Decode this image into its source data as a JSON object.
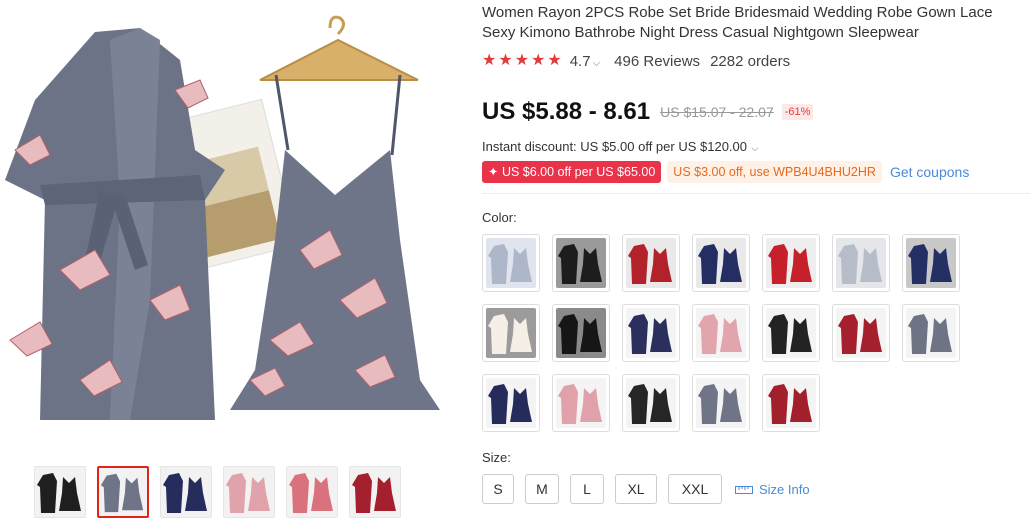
{
  "product": {
    "title": "Women Rayon 2PCS Robe Set Bride Bridesmaid Wedding Robe Gown Lace Sexy Kimono Bathrobe Night Dress Casual Nightgown Sleepwear",
    "rating": "4.7",
    "reviews": "496 Reviews",
    "orders": "2282 orders",
    "star_count": 5
  },
  "price": {
    "current": "US $5.88 - 8.61",
    "original": "US $15.07 - 22.07",
    "discount": "-61%"
  },
  "instant_discount": "Instant discount: US $5.00 off per US $120.00",
  "coupons": {
    "red": "✦ US $6.00 off per US $65.00",
    "orange": "US $3.00 off, use WPB4U4BHU2HR",
    "link": "Get coupons"
  },
  "color": {
    "label": "Color:",
    "swatches": [
      {
        "name": "light-blue-robe",
        "bg": "#dfe4ee",
        "fg": "#aeb7c9"
      },
      {
        "name": "black-set",
        "bg": "#9a9a9a",
        "fg": "#1d1d1d"
      },
      {
        "name": "red-set",
        "bg": "#e9e9e9",
        "fg": "#b3212b"
      },
      {
        "name": "navy-set",
        "bg": "#e9e9e9",
        "fg": "#252e62"
      },
      {
        "name": "red-lace",
        "bg": "#eeeeee",
        "fg": "#c6202a"
      },
      {
        "name": "silver-set",
        "bg": "#e4e6ea",
        "fg": "#b7bdc8"
      },
      {
        "name": "navy-lace",
        "bg": "#c8c8c8",
        "fg": "#243063"
      },
      {
        "name": "white-dress",
        "bg": "#9b9b9b",
        "fg": "#f6efe6"
      },
      {
        "name": "black-lace",
        "bg": "#8a8a8a",
        "fg": "#161616"
      },
      {
        "name": "navy-crane",
        "bg": "#f4f4f4",
        "fg": "#2a2f5d"
      },
      {
        "name": "pink-crane",
        "bg": "#f4f4f4",
        "fg": "#e2a4ad"
      },
      {
        "name": "black-crane",
        "bg": "#f4f4f4",
        "fg": "#232323"
      },
      {
        "name": "burgundy-crane",
        "bg": "#f4f4f4",
        "fg": "#a5202e"
      },
      {
        "name": "grey-crane",
        "bg": "#f4f4f4",
        "fg": "#6f7484"
      },
      {
        "name": "navy-long",
        "bg": "#f4f4f4",
        "fg": "#252b5b"
      },
      {
        "name": "pink-long",
        "bg": "#f4f4f4",
        "fg": "#e1a1aa"
      },
      {
        "name": "black-long",
        "bg": "#f4f4f4",
        "fg": "#262626"
      },
      {
        "name": "grey-long",
        "bg": "#f4f4f4",
        "fg": "#6f7486"
      },
      {
        "name": "burgundy-long",
        "bg": "#f4f4f4",
        "fg": "#a21f2c"
      }
    ]
  },
  "size": {
    "label": "Size:",
    "options": [
      "S",
      "M",
      "L",
      "XL",
      "XXL"
    ],
    "info": "Size Info"
  },
  "thumbnails": [
    {
      "name": "black-set",
      "fg": "#1f1f1f",
      "active": false
    },
    {
      "name": "grey-set",
      "fg": "#6f7486",
      "active": true
    },
    {
      "name": "navy-set",
      "fg": "#262c5c",
      "active": false
    },
    {
      "name": "pink-set",
      "fg": "#e0a2ab",
      "active": false
    },
    {
      "name": "pink-red-set",
      "fg": "#d9727c",
      "active": false
    },
    {
      "name": "burgundy-set",
      "fg": "#a5202e",
      "active": false
    }
  ],
  "colors": {
    "accent_red": "#e23b3b",
    "coupon_red": "#e8334a",
    "coupon_orange": "#e56a1f",
    "link_blue": "#4a8ad6"
  }
}
